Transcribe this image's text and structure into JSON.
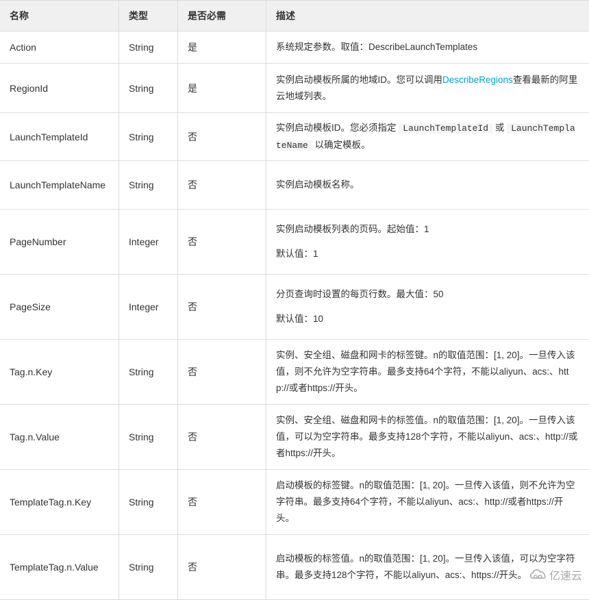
{
  "table": {
    "headers": [
      "名称",
      "类型",
      "是否必需",
      "描述"
    ],
    "rows": [
      {
        "name": "Action",
        "type": "String",
        "required": "是",
        "desc": [
          "系统规定参数。取值：DescribeLaunchTemplates"
        ]
      },
      {
        "name": "RegionId",
        "type": "String",
        "required": "是",
        "desc_before_link": "实例启动模板所属的地域ID。您可以调用",
        "desc_link": "DescribeRegions",
        "desc_after_link": "查看最新的阿里云地域列表。"
      },
      {
        "name": "LaunchTemplateId",
        "type": "String",
        "required": "否",
        "desc_prefix": "实例启动模板ID。您必须指定",
        "code1": "LaunchTemplateId",
        "desc_mid": "或",
        "code2": "LaunchTemplateName",
        "desc_suffix": "以确定模板。"
      },
      {
        "name": "LaunchTemplateName",
        "type": "String",
        "required": "否",
        "desc": [
          "实例启动模板名称。"
        ]
      },
      {
        "name": "PageNumber",
        "type": "Integer",
        "required": "否",
        "desc": [
          "实例启动模板列表的页码。起始值：1",
          "默认值：1"
        ]
      },
      {
        "name": "PageSize",
        "type": "Integer",
        "required": "否",
        "desc": [
          "分页查询时设置的每页行数。最大值：50",
          "默认值：10"
        ]
      },
      {
        "name": "Tag.n.Key",
        "type": "String",
        "required": "否",
        "desc": [
          "实例、安全组、磁盘和网卡的标签键。n的取值范围：[1, 20]。一旦传入该值，则不允许为空字符串。最多支持64个字符，不能以aliyun、acs:、http://或者https://开头。"
        ]
      },
      {
        "name": "Tag.n.Value",
        "type": "String",
        "required": "否",
        "desc": [
          "实例、安全组、磁盘和网卡的标签值。n的取值范围：[1, 20]。一旦传入该值，可以为空字符串。最多支持128个字符，不能以aliyun、acs:、http://或者https://开头。"
        ]
      },
      {
        "name": "TemplateTag.n.Key",
        "type": "String",
        "required": "否",
        "desc": [
          "启动模板的标签键。n的取值范围：[1, 20]。一旦传入该值，则不允许为空字符串。最多支持64个字符，不能以aliyun、acs:、http://或者https://开头。"
        ]
      },
      {
        "name": "TemplateTag.n.Value",
        "type": "String",
        "required": "否",
        "desc": [
          "启动模板的标签值。n的取值范围：[1, 20]。一旦传入该值，可以为空字符串。最多支持128个字符，不能以aliyun、acs:、https://开头。"
        ]
      }
    ]
  },
  "colors": {
    "link": "#00a2ca",
    "header_bg": "#f0f0f0",
    "border": "#dddddd",
    "text": "#333333"
  },
  "watermark": {
    "icon": "cloud-logo-icon",
    "text": "亿速云"
  }
}
